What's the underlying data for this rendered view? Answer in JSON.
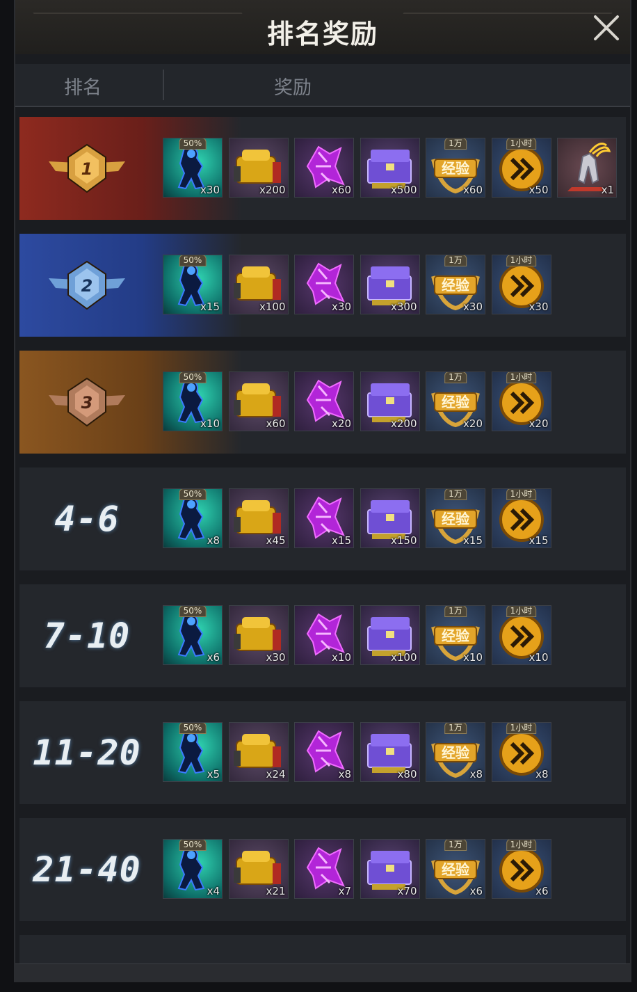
{
  "window": {
    "title": "排名奖励",
    "close_label": "close"
  },
  "header": {
    "rank_col": "排名",
    "reward_col": "奖励"
  },
  "colors": {
    "first": "#8a2a22",
    "second": "#2c4a9a",
    "third": "#8a5a2a"
  },
  "rows": [
    {
      "rank": "1",
      "style": "first",
      "items": [
        {
          "type": "cyan",
          "tag": "50%",
          "qty": "x30"
        },
        {
          "type": "gold",
          "qty": "x200"
        },
        {
          "type": "purple",
          "qty": "x60"
        },
        {
          "type": "chest",
          "qty": "x500"
        },
        {
          "type": "exp",
          "tag": "1万",
          "qty": "x60",
          "label": "经验"
        },
        {
          "type": "boost",
          "tag": "1小时",
          "qty": "x50"
        },
        {
          "type": "mecha",
          "qty": "x1"
        }
      ]
    },
    {
      "rank": "2",
      "style": "second",
      "items": [
        {
          "type": "cyan",
          "tag": "50%",
          "qty": "x15"
        },
        {
          "type": "gold",
          "qty": "x100"
        },
        {
          "type": "purple",
          "qty": "x30"
        },
        {
          "type": "chest",
          "qty": "x300"
        },
        {
          "type": "exp",
          "tag": "1万",
          "qty": "x30",
          "label": "经验"
        },
        {
          "type": "boost",
          "tag": "1小时",
          "qty": "x30"
        }
      ]
    },
    {
      "rank": "3",
      "style": "third",
      "items": [
        {
          "type": "cyan",
          "tag": "50%",
          "qty": "x10"
        },
        {
          "type": "gold",
          "qty": "x60"
        },
        {
          "type": "purple",
          "qty": "x20"
        },
        {
          "type": "chest",
          "qty": "x200"
        },
        {
          "type": "exp",
          "tag": "1万",
          "qty": "x20",
          "label": "经验"
        },
        {
          "type": "boost",
          "tag": "1小时",
          "qty": "x20"
        }
      ]
    },
    {
      "rank": "4-6",
      "style": "plain",
      "items": [
        {
          "type": "cyan",
          "tag": "50%",
          "qty": "x8"
        },
        {
          "type": "gold",
          "qty": "x45"
        },
        {
          "type": "purple",
          "qty": "x15"
        },
        {
          "type": "chest",
          "qty": "x150"
        },
        {
          "type": "exp",
          "tag": "1万",
          "qty": "x15",
          "label": "经验"
        },
        {
          "type": "boost",
          "tag": "1小时",
          "qty": "x15"
        }
      ]
    },
    {
      "rank": "7-10",
      "style": "plain",
      "items": [
        {
          "type": "cyan",
          "tag": "50%",
          "qty": "x6"
        },
        {
          "type": "gold",
          "qty": "x30"
        },
        {
          "type": "purple",
          "qty": "x10"
        },
        {
          "type": "chest",
          "qty": "x100"
        },
        {
          "type": "exp",
          "tag": "1万",
          "qty": "x10",
          "label": "经验"
        },
        {
          "type": "boost",
          "tag": "1小时",
          "qty": "x10"
        }
      ]
    },
    {
      "rank": "11-20",
      "style": "plain",
      "items": [
        {
          "type": "cyan",
          "tag": "50%",
          "qty": "x5"
        },
        {
          "type": "gold",
          "qty": "x24"
        },
        {
          "type": "purple",
          "qty": "x8"
        },
        {
          "type": "chest",
          "qty": "x80"
        },
        {
          "type": "exp",
          "tag": "1万",
          "qty": "x8",
          "label": "经验"
        },
        {
          "type": "boost",
          "tag": "1小时",
          "qty": "x8"
        }
      ]
    },
    {
      "rank": "21-40",
      "style": "plain",
      "items": [
        {
          "type": "cyan",
          "tag": "50%",
          "qty": "x4"
        },
        {
          "type": "gold",
          "qty": "x21"
        },
        {
          "type": "purple",
          "qty": "x7"
        },
        {
          "type": "chest",
          "qty": "x70"
        },
        {
          "type": "exp",
          "tag": "1万",
          "qty": "x6",
          "label": "经验"
        },
        {
          "type": "boost",
          "tag": "1小时",
          "qty": "x6"
        }
      ]
    }
  ]
}
